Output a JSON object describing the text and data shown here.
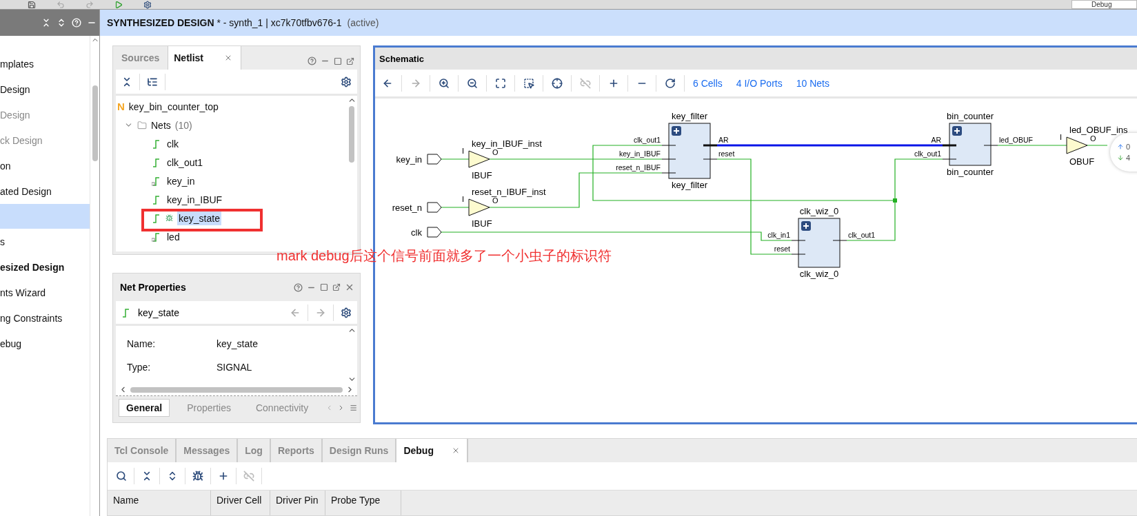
{
  "toolbar": {
    "layout_dropdown": "Debug"
  },
  "flow_navigator": {
    "items": [
      {
        "label": "mplates",
        "kind": "normal",
        "selected": false
      },
      {
        "label": "Design",
        "kind": "normal",
        "selected": false
      },
      {
        "label": "Design",
        "kind": "grey",
        "selected": false
      },
      {
        "label": "ck Design",
        "kind": "grey",
        "selected": false
      },
      {
        "label": "on",
        "kind": "normal",
        "selected": false
      },
      {
        "label": "ated Design",
        "kind": "normal",
        "selected": false
      },
      {
        "kind": "blank",
        "selected": true
      },
      {
        "label": "s",
        "kind": "normal",
        "selected": false
      },
      {
        "label": "esized Design",
        "kind": "bold",
        "selected": false
      },
      {
        "label": "nts Wizard",
        "kind": "normal",
        "selected": false
      },
      {
        "label": "ng Constraints",
        "kind": "normal",
        "selected": false
      },
      {
        "label": "ebug",
        "kind": "normal",
        "selected": false
      }
    ]
  },
  "header": {
    "title": "SYNTHESIZED DESIGN",
    "rest": " * - synth_1 | xc7k70tfbv676-1",
    "status": "(active)"
  },
  "netlist": {
    "tabs": [
      {
        "label": "Sources",
        "selected": false
      },
      {
        "label": "Netlist",
        "selected": true
      }
    ],
    "root": {
      "icon_letter": "N",
      "name": "key_bin_counter_top"
    },
    "group": {
      "name": "Nets",
      "count": "(10)",
      "expanded": true
    },
    "nets": [
      {
        "name": "clk",
        "kind": "net",
        "debug": false,
        "selected": false
      },
      {
        "name": "clk_out1",
        "kind": "net",
        "debug": false,
        "selected": false
      },
      {
        "name": "key_in",
        "kind": "port",
        "debug": false,
        "selected": false
      },
      {
        "name": "key_in_IBUF",
        "kind": "net",
        "debug": false,
        "selected": false
      },
      {
        "name": "key_state",
        "kind": "net",
        "debug": true,
        "selected": true
      },
      {
        "name": "led",
        "kind": "port",
        "debug": false,
        "selected": false
      }
    ]
  },
  "net_properties": {
    "title": "Net Properties",
    "net": "key_state",
    "rows": [
      {
        "label": "Name:",
        "value": "key_state"
      },
      {
        "label": "Type:",
        "value": "SIGNAL"
      }
    ],
    "tabs": [
      {
        "label": "General",
        "selected": true
      },
      {
        "label": "Properties",
        "selected": false
      },
      {
        "label": "Connectivity",
        "selected": false
      }
    ]
  },
  "annotation": {
    "text": "mark debug后这个信号前面就多了一个小虫子的标识符"
  },
  "schematic": {
    "title": "Schematic",
    "links": [
      "6 Cells",
      "4 I/O Ports",
      "10 Nets"
    ],
    "ports": [
      {
        "name": "key_in"
      },
      {
        "name": "reset_n"
      },
      {
        "name": "clk"
      }
    ],
    "buffers": [
      {
        "instance": "key_in_IBUF_inst",
        "type": "IBUF",
        "in": "I",
        "out": "O"
      },
      {
        "instance": "reset_n_IBUF_inst",
        "type": "IBUF",
        "in": "I",
        "out": "O"
      },
      {
        "instance": "led_OBUF_ins",
        "type": "OBUF",
        "in": "I",
        "out": "O"
      }
    ],
    "blocks": [
      {
        "instance": "key_filter",
        "cell": "key_filter",
        "inputs": [
          "clk_out1",
          "key_in_IBUF",
          "reset_n_IBUF"
        ],
        "outputs": [
          "AR",
          "reset"
        ]
      },
      {
        "instance": "bin_counter",
        "cell": "bin_counter",
        "inputs": [
          "AR",
          "clk_out1"
        ],
        "outputs": [
          "led_OBUF"
        ]
      },
      {
        "instance": "clk_wiz_0",
        "cell": "clk_wiz_0",
        "inputs": [
          "clk_in1",
          "reset"
        ],
        "outputs": [
          "clk_out1"
        ]
      }
    ],
    "popup": {
      "up": "0",
      "down": "4"
    }
  },
  "bottom": {
    "tabs": [
      {
        "label": "Tcl Console",
        "selected": false
      },
      {
        "label": "Messages",
        "selected": false
      },
      {
        "label": "Log",
        "selected": false
      },
      {
        "label": "Reports",
        "selected": false
      },
      {
        "label": "Design Runs",
        "selected": false
      },
      {
        "label": "Debug",
        "selected": true
      }
    ],
    "columns": [
      "Name",
      "Driver Cell",
      "Driver Pin",
      "Probe Type"
    ]
  }
}
